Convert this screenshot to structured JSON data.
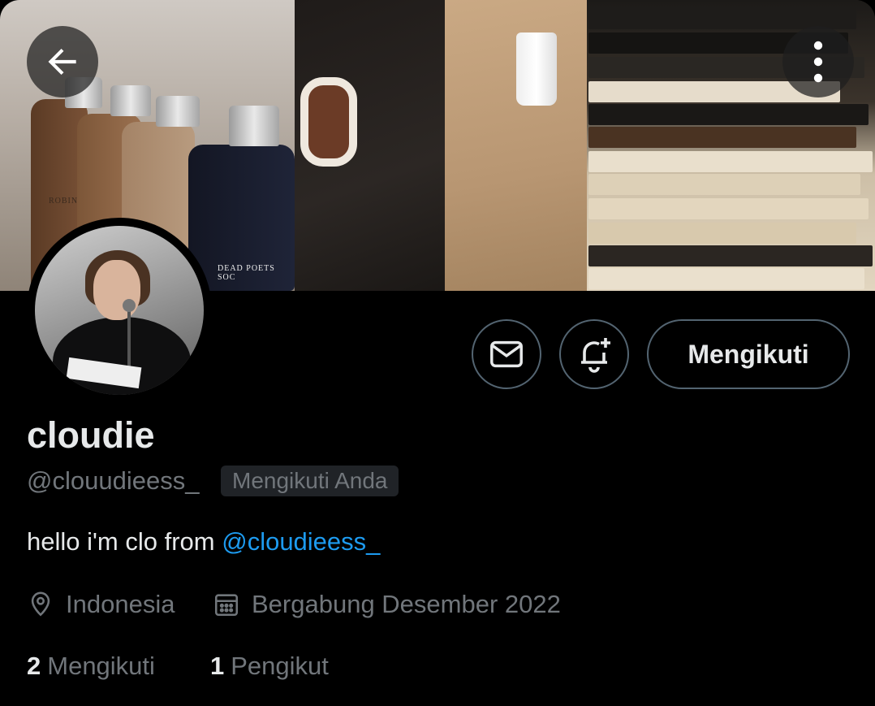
{
  "profile": {
    "name": "cloudie",
    "handle": "@clouudieess_",
    "follows_you_badge": "Mengikuti Anda",
    "bio_text": "hello i'm clo from ",
    "bio_mention": "@cloudieess_",
    "location": "Indonesia",
    "joined": "Bergabung Desember 2022",
    "following_count": "2",
    "following_label": "Mengikuti",
    "followers_count": "1",
    "followers_label": "Pengikut"
  },
  "actions": {
    "follow_button": "Mengikuti"
  },
  "banner": {
    "bottle_label": "DEAD POETS SOC",
    "bottle_label_2": "ROBIN"
  },
  "icons": {
    "back": "arrow-left-icon",
    "more": "more-vertical-icon",
    "mail": "mail-icon",
    "notify": "bell-plus-icon",
    "location": "location-pin-icon",
    "calendar": "calendar-icon"
  },
  "colors": {
    "background": "#000000",
    "text_primary": "#e7e9ea",
    "text_secondary": "#71767b",
    "mention": "#1d9bf0",
    "border": "#536471"
  }
}
